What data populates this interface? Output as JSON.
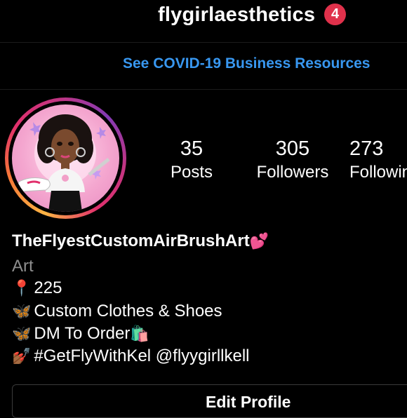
{
  "header": {
    "username": "flygirlaesthetics",
    "notification_count": "4"
  },
  "banner": {
    "link_text": "See COVID-19 Business Resources"
  },
  "stats": {
    "posts": {
      "value": "35",
      "label": "Posts"
    },
    "followers": {
      "value": "305",
      "label": "Followers"
    },
    "following": {
      "value": "273",
      "label": "Following"
    }
  },
  "bio": {
    "name": "TheFlyestCustomAirBrushArt",
    "name_emoji": "💕",
    "category": "Art",
    "lines": [
      {
        "emoji": "📍",
        "text": "225"
      },
      {
        "emoji": "🦋",
        "text": "Custom Clothes & Shoes"
      },
      {
        "emoji": "🦋",
        "text": "DM To Order",
        "trail_emoji": "🛍️"
      },
      {
        "emoji": "💅🏾",
        "text": "#GetFlyWithKel @flyygirllkell"
      }
    ]
  },
  "actions": {
    "edit_profile": "Edit Profile"
  },
  "colors": {
    "background": "#000000",
    "link": "#3897f0",
    "badge": "#e0314b",
    "muted": "#8e8e8e"
  }
}
